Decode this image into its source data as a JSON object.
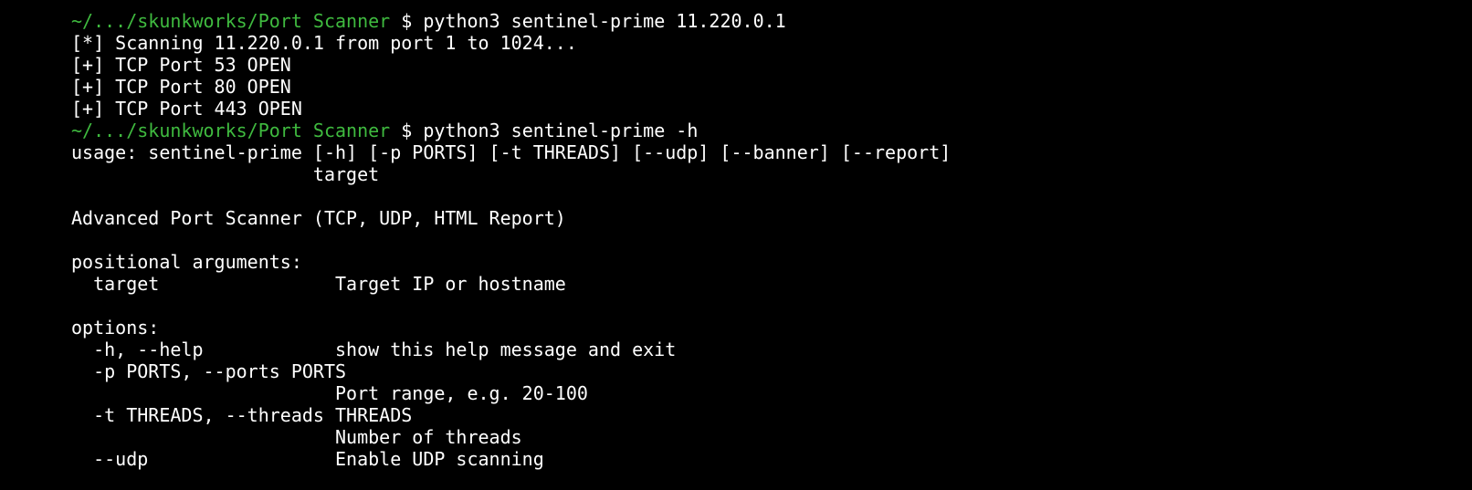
{
  "terminal": {
    "prompt_path": "~/.../skunkworks/Port Scanner",
    "prompt_symbol": "$",
    "colors": {
      "background": "#000000",
      "prompt_path": "#3fba3f",
      "text": "#ffffff"
    },
    "commands": [
      {
        "command": "python3 sentinel-prime 11.220.0.1",
        "output": [
          "[*] Scanning 11.220.0.1 from port 1 to 1024...",
          "[+] TCP Port 53 OPEN",
          "[+] TCP Port 80 OPEN",
          "[+] TCP Port 443 OPEN"
        ]
      },
      {
        "command": "python3 sentinel-prime -h",
        "output": [
          "usage: sentinel-prime [-h] [-p PORTS] [-t THREADS] [--udp] [--banner] [--report]",
          "                      target",
          "",
          "Advanced Port Scanner (TCP, UDP, HTML Report)",
          "",
          "positional arguments:",
          "  target                Target IP or hostname",
          "",
          "options:",
          "  -h, --help            show this help message and exit",
          "  -p PORTS, --ports PORTS",
          "                        Port range, e.g. 20-100",
          "  -t THREADS, --threads THREADS",
          "                        Number of threads",
          "  --udp                 Enable UDP scanning"
        ]
      }
    ]
  }
}
